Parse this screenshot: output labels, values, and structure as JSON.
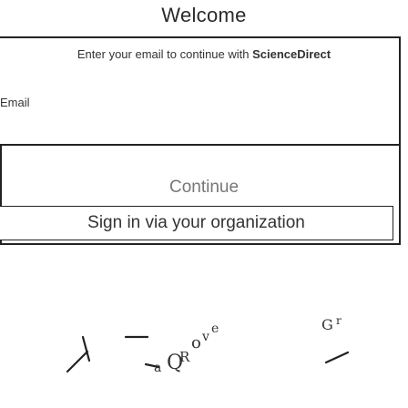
{
  "header": {
    "title": "Welcome"
  },
  "form": {
    "prompt_prefix": "Enter your email to continue with ",
    "prompt_brand": "ScienceDirect",
    "email_label": "Email",
    "continue_label": "Continue",
    "sso_label": "Sign in via your organization"
  },
  "colors": {
    "border": "#222222",
    "muted_text": "#777777",
    "background": "#ffffff"
  }
}
